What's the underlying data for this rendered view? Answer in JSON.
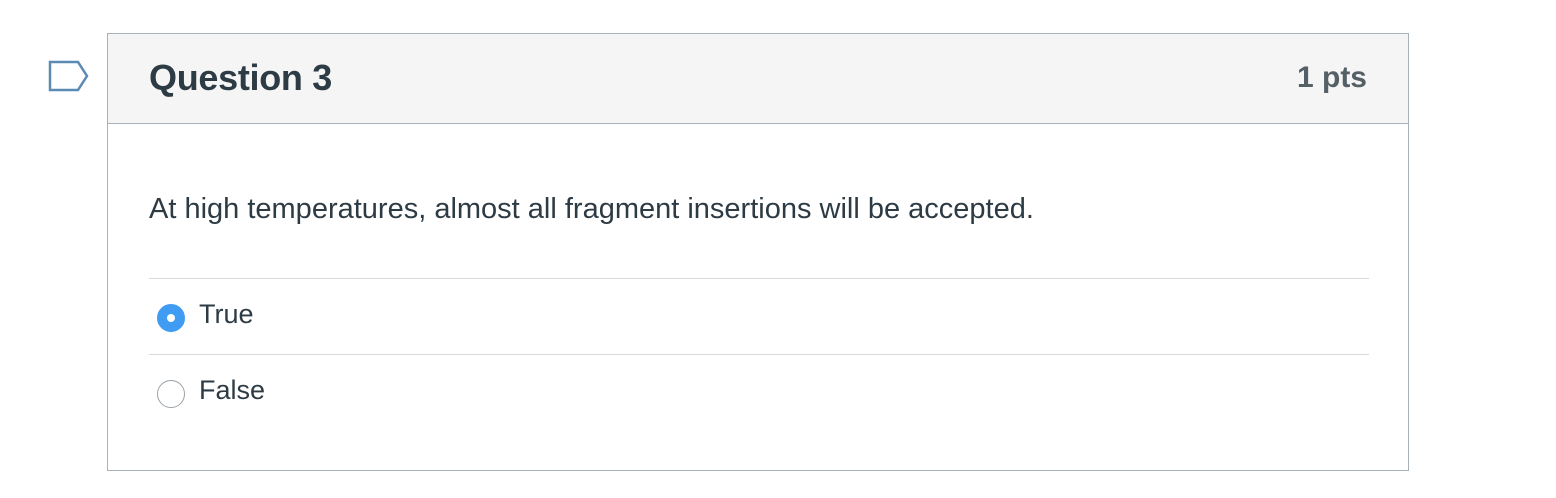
{
  "question": {
    "title": "Question 3",
    "points": "1 pts",
    "text": "At high temperatures, almost all fragment insertions will be accepted.",
    "answers": [
      {
        "label": "True",
        "selected": true
      },
      {
        "label": "False",
        "selected": false
      }
    ]
  },
  "colors": {
    "accent": "#3f9cf2",
    "header_bg": "#f5f5f5",
    "border": "#aab1b7",
    "text": "#2d3b45",
    "flag": "#5b8bb4"
  },
  "icons": {
    "flag": "flag-question-icon"
  }
}
